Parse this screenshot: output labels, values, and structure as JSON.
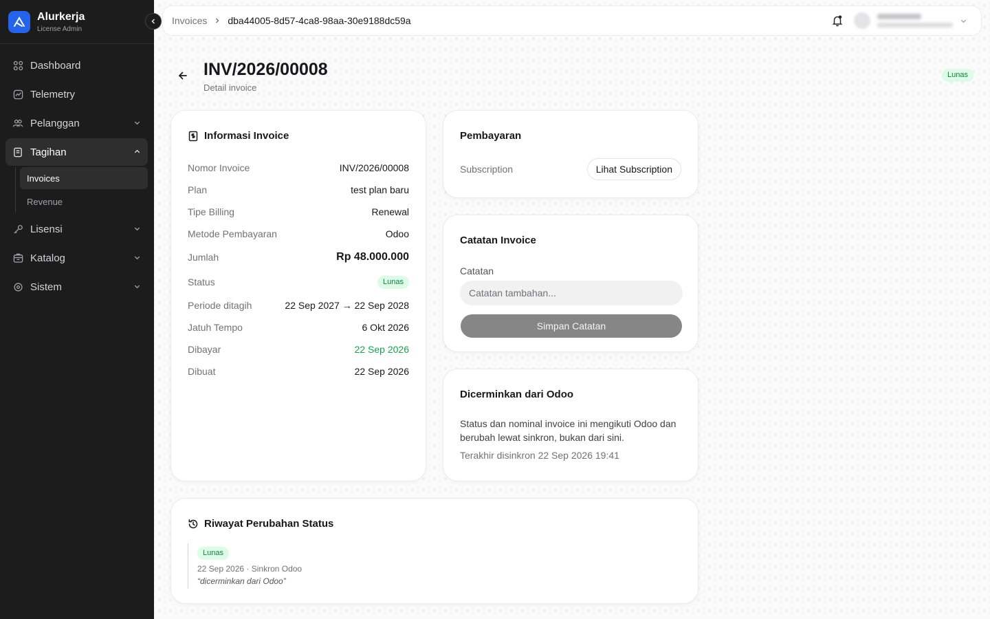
{
  "brand": {
    "name": "Alurkerja",
    "subtitle": "License Admin"
  },
  "sidebar": {
    "items": [
      {
        "label": "Dashboard",
        "icon": "dashboard-icon"
      },
      {
        "label": "Telemetry",
        "icon": "telemetry-icon"
      },
      {
        "label": "Pelanggan",
        "icon": "users-icon"
      },
      {
        "label": "Tagihan",
        "icon": "billing-icon"
      },
      {
        "label": "Lisensi",
        "icon": "key-icon"
      },
      {
        "label": "Katalog",
        "icon": "catalog-icon"
      },
      {
        "label": "Sistem",
        "icon": "settings-icon"
      }
    ],
    "sub_items": [
      {
        "label": "Invoices"
      },
      {
        "label": "Revenue"
      }
    ]
  },
  "breadcrumb": {
    "parent": "Invoices",
    "current": "dba44005-8d57-4ca8-98aa-30e9188dc59a"
  },
  "page": {
    "title": "INV/2026/00008",
    "subtitle": "Detail invoice",
    "status": "Lunas"
  },
  "info": {
    "title": "Informasi Invoice",
    "rows": [
      {
        "key": "Nomor Invoice",
        "value": "INV/2026/00008"
      },
      {
        "key": "Plan",
        "value": "test plan baru"
      },
      {
        "key": "Tipe Billing",
        "value": "Renewal"
      },
      {
        "key": "Metode Pembayaran",
        "value": "Odoo"
      },
      {
        "key": "Jumlah",
        "value": "Rp 48.000.000"
      },
      {
        "key": "Status",
        "value": "Lunas"
      },
      {
        "key": "Periode ditagih",
        "value": "22 Sep 2027 → 22 Sep 2028"
      },
      {
        "key": "Jatuh Tempo",
        "value": "6 Okt 2026"
      },
      {
        "key": "Dibayar",
        "value": "22 Sep 2026"
      },
      {
        "key": "Dibuat",
        "value": "22 Sep 2026"
      }
    ]
  },
  "payment": {
    "title": "Pembayaran",
    "label": "Subscription",
    "button": "Lihat Subscription"
  },
  "notes": {
    "title": "Catatan Invoice",
    "label": "Catatan",
    "placeholder": "Catatan tambahan...",
    "button": "Simpan Catatan"
  },
  "odoo": {
    "title": "Dicerminkan dari Odoo",
    "text": "Status dan nominal invoice ini mengikuti Odoo dan berubah lewat sinkron, bukan dari sini.",
    "sync": "Terakhir disinkron 22 Sep 2026 19:41"
  },
  "history": {
    "title": "Riwayat Perubahan Status",
    "entries": [
      {
        "status": "Lunas",
        "meta": "22 Sep 2026 · Sinkron Odoo",
        "note": "“dicerminkan dari Odoo”"
      }
    ]
  },
  "colors": {
    "sidebar_bg": "#1c1c1c",
    "brand": "#2563eb",
    "success": "#16a34a",
    "success_bg": "#dcfce7"
  }
}
